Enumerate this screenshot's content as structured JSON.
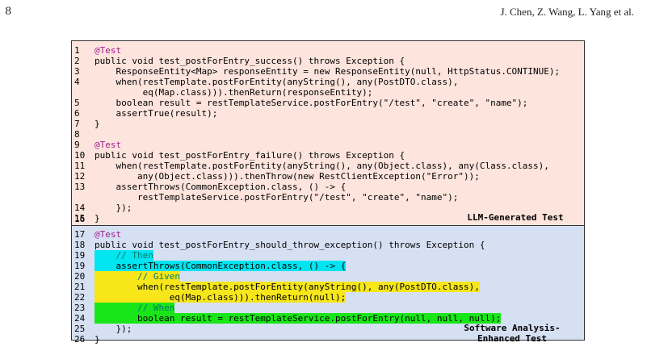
{
  "header": {
    "page_number": "8",
    "running_head": "J. Chen, Z. Wang, L. Yang et al."
  },
  "labels": {
    "llm_test": "LLM-Generated Test",
    "sa_test_line1": "Software Analysis-",
    "sa_test_line2": "Enhanced Test"
  },
  "lines": [
    {
      "n": "1",
      "text": "@Test"
    },
    {
      "n": "2",
      "text": "public void test_postForEntry_success() throws Exception {"
    },
    {
      "n": "3",
      "text": "    ResponseEntity<Map> responseEntity = new ResponseEntity(null, HttpStatus.CONTINUE);"
    },
    {
      "n": "4",
      "text": "    when(restTemplate.postForEntity(anyString(), any(PostDTO.class),"
    },
    {
      "n": "",
      "text": "         eq(Map.class))).thenReturn(responseEntity);"
    },
    {
      "n": "5",
      "text": "    boolean result = restTemplateService.postForEntry(\"/test\", \"create\", \"name\");"
    },
    {
      "n": "6",
      "text": "    assertTrue(result);"
    },
    {
      "n": "7",
      "text": "}"
    },
    {
      "n": "8",
      "text": ""
    },
    {
      "n": "9",
      "text": "@Test"
    },
    {
      "n": "10",
      "text": "public void test_postForEntry_failure() throws Exception {"
    },
    {
      "n": "11",
      "text": "    when(restTemplate.postForEntity(anyString(), any(Object.class), any(Class.class),"
    },
    {
      "n": "12",
      "text": "        any(Object.class))).thenThrow(new RestClientException(\"Error\"));"
    },
    {
      "n": "13",
      "text": "    assertThrows(CommonException.class, () -> {"
    },
    {
      "n": "",
      "text": "        restTemplateService.postForEntry(\"/test\", \"create\", \"name\");"
    },
    {
      "n": "14",
      "text": "    });"
    },
    {
      "n": "15",
      "text": "}"
    },
    {
      "n": "16",
      "text": ""
    },
    {
      "n": "17",
      "text": "@Test"
    },
    {
      "n": "18",
      "text": "public void test_postForEntry_should_throw_exception() throws Exception {"
    },
    {
      "n": "19",
      "text": "    // Then"
    },
    {
      "n": "19",
      "text": "    assertThrows(CommonException.class, () -> {"
    },
    {
      "n": "20",
      "text": "        // Given"
    },
    {
      "n": "21",
      "text": "        when(restTemplate.postForEntity(anyString(), any(PostDTO.class),"
    },
    {
      "n": "22",
      "text": "              eq(Map.class))).thenReturn(null);"
    },
    {
      "n": "23",
      "text": "        // When"
    },
    {
      "n": "24",
      "text": "        boolean result = restTemplateService.postForEntry(null, null, null);"
    },
    {
      "n": "25",
      "text": "    });"
    },
    {
      "n": "26",
      "text": "}"
    }
  ],
  "colors": {
    "top_section_bg": "#fde4dd",
    "bottom_section_bg": "#d6e0f3",
    "then_highlight": "#00e5f0",
    "given_highlight": "#f6e61a",
    "when_highlight": "#19e619"
  }
}
